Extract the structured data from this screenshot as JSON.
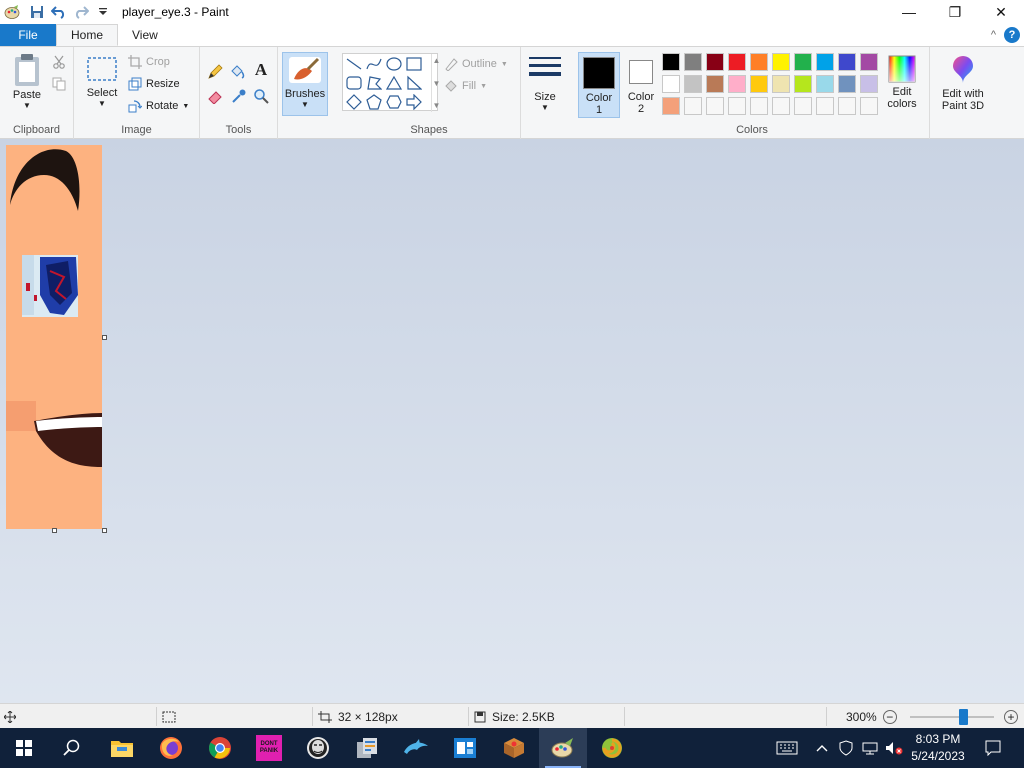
{
  "window": {
    "title": "player_eye.3 - Paint",
    "minimize_glyph": "—",
    "restore_glyph": "❐",
    "close_glyph": "✕"
  },
  "tabs": [
    {
      "label": "File"
    },
    {
      "label": "Home"
    },
    {
      "label": "View"
    }
  ],
  "ribbon": {
    "clipboard": {
      "label": "Clipboard",
      "paste": "Paste"
    },
    "image": {
      "label": "Image",
      "select": "Select",
      "crop": "Crop",
      "resize": "Resize",
      "rotate": "Rotate"
    },
    "tools": {
      "label": "Tools"
    },
    "brushes": {
      "label": "Brushes"
    },
    "shapes": {
      "label": "Shapes",
      "outline": "Outline",
      "fill": "Fill"
    },
    "size": {
      "label": "Size"
    },
    "colors": {
      "label": "Colors",
      "color1_line1": "Color",
      "color1_line2": "1",
      "color2_line1": "Color",
      "color2_line2": "2",
      "color1_value": "#000000",
      "color2_value": "#ffffff",
      "edit_colors_line1": "Edit",
      "edit_colors_line2": "colors",
      "edit_paint3d_line1": "Edit with",
      "edit_paint3d_line2": "Paint 3D",
      "palette_row1": [
        "#000000",
        "#7f7f7f",
        "#880015",
        "#ed1c24",
        "#ff7f27",
        "#fff200",
        "#22b14c",
        "#00a2e8",
        "#3f48cc",
        "#a349a4"
      ],
      "palette_row2": [
        "#ffffff",
        "#c3c3c3",
        "#b97a57",
        "#ffaec9",
        "#ffc90e",
        "#efe4b0",
        "#b5e61d",
        "#99d9ea",
        "#7092be",
        "#c8bfe7"
      ],
      "palette_row3": [
        "#f4a07a",
        "#f7f7f7",
        "#f7f7f7",
        "#f7f7f7",
        "#f7f7f7",
        "#f7f7f7",
        "#f7f7f7",
        "#f7f7f7",
        "#f7f7f7",
        "#f7f7f7"
      ]
    }
  },
  "status": {
    "dimensions": "32 × 128px",
    "size": "Size: 2.5KB",
    "zoom": "300%",
    "zoom_slider_fraction": 0.63
  },
  "taskbar": {
    "time": "8:03 PM",
    "date": "5/24/2023",
    "sticker_text": "DONT PANIK"
  }
}
